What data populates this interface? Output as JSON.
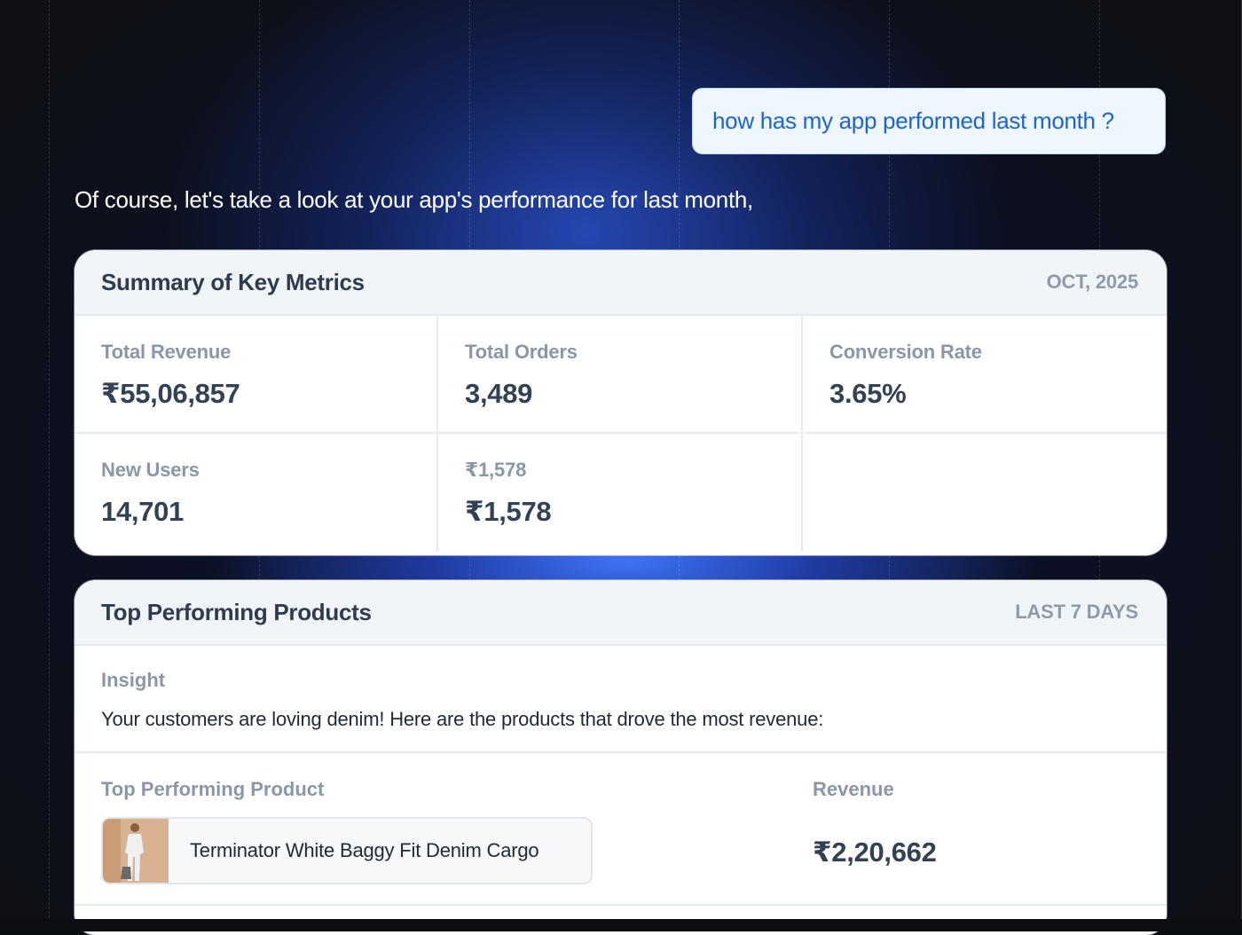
{
  "chat": {
    "user_message": "how has my app performed last month ?",
    "assistant_message": "Of course, let's take a look at your app's performance for last month,"
  },
  "summary_card": {
    "title": "Summary of Key Metrics",
    "period": "OCT, 2025",
    "metrics": [
      {
        "label": "Total Revenue",
        "value": "₹55,06,857"
      },
      {
        "label": "Total Orders",
        "value": "3,489"
      },
      {
        "label": "Conversion Rate",
        "value": "3.65%"
      },
      {
        "label": "New Users",
        "value": "14,701"
      },
      {
        "label": "₹1,578",
        "value": "₹1,578"
      }
    ]
  },
  "products_card": {
    "title": "Top Performing Products",
    "period": "LAST 7 DAYS",
    "insight_label": "Insight",
    "insight_text": "Your customers are loving denim! Here are the products that drove the most revenue:",
    "columns": {
      "product": "Top Performing Product",
      "revenue": "Revenue"
    },
    "products": [
      {
        "name": "Terminator White Baggy Fit Denim Cargo",
        "revenue": "₹2,20,662",
        "thumbnail": "product-photo"
      }
    ]
  }
}
